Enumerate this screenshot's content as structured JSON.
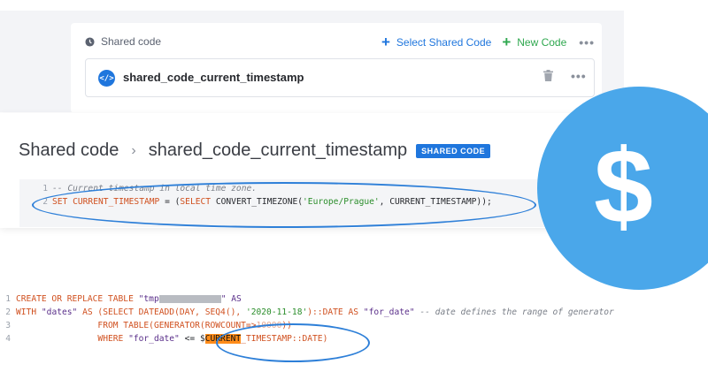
{
  "shared_code_card": {
    "title": "Shared code",
    "select_label": "Select Shared Code",
    "new_label": "New Code",
    "more": "•••",
    "code_item": {
      "icon_text": "</>",
      "name": "shared_code_current_timestamp",
      "more": "•••"
    }
  },
  "detail": {
    "breadcrumb_root": "Shared code",
    "separator": "›",
    "breadcrumb_current": "shared_code_current_timestamp",
    "badge": "SHARED CODE"
  },
  "editor": {
    "lines": [
      {
        "num": "1",
        "comment": "-- Current timestamp in local time zone."
      },
      {
        "num": "2",
        "kw1": "SET CURRENT_TIMESTAMP",
        "eq": " = (",
        "kw2": "SELECT",
        "fn": " CONVERT_TIMEZONE(",
        "str": "'Europe/Prague'",
        "rest": ", CURRENT_TIMESTAMP));"
      }
    ]
  },
  "sql": {
    "l1": {
      "num": "1",
      "a": "CREATE OR REPLACE TABLE ",
      "b": "\"tmp",
      "c": "\" AS"
    },
    "l2": {
      "num": "2",
      "a": "WITH ",
      "b": "\"dates\"",
      "c": " AS (SELECT DATEADD(DAY, SEQ4(), ",
      "d": "'2020-11-18'",
      "e": ")::DATE AS ",
      "f": "\"for_date\"",
      "g": " -- date defines the range of generator"
    },
    "l3": {
      "num": "3",
      "a": "                FROM TABLE(GENERATOR(ROWCOUNT=>",
      "b": "10000",
      "c": "))"
    },
    "l4": {
      "num": "4",
      "a": "                WHERE ",
      "b": "\"for_date\"",
      "c": " <= $",
      "d": "CURRENT",
      "e": "_TIMESTAMP::DATE)"
    }
  },
  "dollar": "$",
  "colors": {
    "accent": "#1f76dd",
    "green": "#2fa84f",
    "keyword": "#d0501f",
    "highlight": "#ff8c1a",
    "dollar_bg": "#4aa7ea"
  }
}
